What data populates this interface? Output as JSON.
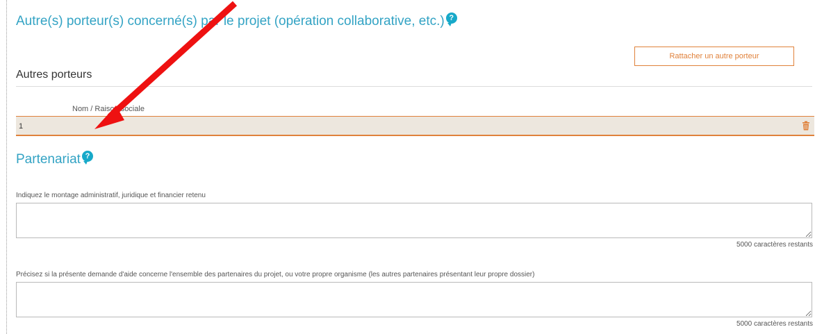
{
  "section": {
    "title": "Autre(s) porteur(s) concerné(s) par le projet (opération collaborative, etc.)",
    "help_icon": "question-bubble-icon"
  },
  "attach_button": {
    "label": "Rattacher un autre porteur"
  },
  "autres_porteurs": {
    "title": "Autres porteurs",
    "column_header": "Nom / Raison sociale",
    "rows": [
      {
        "index": "1",
        "name": "",
        "delete_icon": "trash-icon"
      }
    ]
  },
  "partenariat": {
    "title": "Partenariat",
    "help_icon": "question-bubble-icon",
    "fields": [
      {
        "label": "Indiquez le montage administratif, juridique et financier retenu",
        "value": "",
        "counter": "5000 caractères restants"
      },
      {
        "label": "Précisez si la présente demande d'aide concerne l'ensemble des partenaires du projet, ou votre propre organisme (les autres partenaires présentant leur propre dossier)",
        "value": "",
        "counter": "5000 caractères restants"
      }
    ]
  },
  "colors": {
    "accent_orange": "#e0813a",
    "heading_blue": "#33a3c4",
    "arrow_red": "#ee1111"
  }
}
